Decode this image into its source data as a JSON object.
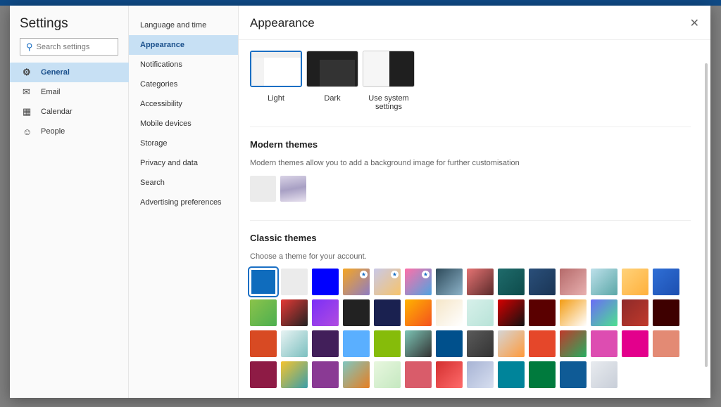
{
  "settings": {
    "title": "Settings",
    "search_placeholder": "Search settings",
    "categories": [
      {
        "label": "General",
        "icon": "gear-icon",
        "selected": true
      },
      {
        "label": "Email",
        "icon": "mail-icon"
      },
      {
        "label": "Calendar",
        "icon": "calendar-icon"
      },
      {
        "label": "People",
        "icon": "people-icon"
      }
    ]
  },
  "subnav": [
    {
      "label": "Language and time"
    },
    {
      "label": "Appearance",
      "selected": true
    },
    {
      "label": "Notifications"
    },
    {
      "label": "Categories"
    },
    {
      "label": "Accessibility"
    },
    {
      "label": "Mobile devices"
    },
    {
      "label": "Storage"
    },
    {
      "label": "Privacy and data"
    },
    {
      "label": "Search"
    },
    {
      "label": "Advertising preferences"
    }
  ],
  "main": {
    "title": "Appearance",
    "close_icon": "close-icon",
    "modes": [
      {
        "label": "Light",
        "selected": true
      },
      {
        "label": "Dark"
      },
      {
        "label": "Use system settings"
      }
    ],
    "modern": {
      "title": "Modern themes",
      "description": "Modern themes allow you to add a background image for further customisation"
    },
    "classic": {
      "title": "Classic themes",
      "description": "Choose a theme for your account."
    }
  },
  "accent": "#1a6fc4",
  "classic_tiles": [
    [
      "#0f6cbd"
    ],
    [
      "#ebebeb"
    ],
    [
      "#0000ff"
    ],
    [
      "#f5a623",
      "#8e7cc3",
      1
    ],
    [
      "#c9c9e8",
      "#f6c36b",
      1
    ],
    [
      "#ff6fa8",
      "#4fa3e0",
      1
    ],
    [
      "#2d4a5a",
      "#8db3c9"
    ],
    [
      "#e57373",
      "#5a2a2a"
    ],
    [
      "#1f6b6b",
      "#0d4b4b"
    ],
    [
      "#2a4f7a",
      "#1a3555"
    ],
    [
      "#b56a6a",
      "#e8b0b0"
    ],
    [
      "#bde0ea",
      "#5aa7a7"
    ],
    [
      "#ffd27a",
      "#ffb03b"
    ],
    [
      "#2f6fd6",
      "#1d4fb0"
    ],
    [
      "#8bc34a",
      "#4caf50"
    ],
    [
      "#e53935",
      "#222222"
    ],
    [
      "#7b2ff7",
      "#b04ce0"
    ],
    [
      "#222222"
    ],
    [
      "#1a2150"
    ],
    [
      "#ffb300",
      "#f4511e"
    ],
    [
      "#f5e6c8",
      "#ffffff"
    ],
    [
      "#d7f0ea",
      "#b8e3d8"
    ],
    [
      "#d50000",
      "#111111"
    ],
    [
      "#5a0000"
    ],
    [
      "#f39c12",
      "#ffffff"
    ],
    [
      "#6a6cf6",
      "#4ee08f"
    ],
    [
      "#8e2a2a",
      "#c0392b"
    ],
    [
      "#3e0000"
    ],
    [
      "#d84a23"
    ],
    [
      "#e8f3f3",
      "#7bbfbf"
    ],
    [
      "#421f5a"
    ],
    [
      "#5aafff"
    ],
    [
      "#86bc0a"
    ],
    [
      "#7cc4b5",
      "#333333"
    ],
    [
      "#00508c"
    ],
    [
      "#5a5a5a",
      "#333333"
    ],
    [
      "#d5d5d5",
      "#ff9a3c"
    ],
    [
      "#e5472a"
    ],
    [
      "#c0392b",
      "#27ae60"
    ],
    [
      "#dd4db1"
    ],
    [
      "#e3008c"
    ],
    [
      "#e38a74"
    ],
    [
      "#8e1b45"
    ],
    [
      "#f4c430",
      "#3b9ea8"
    ],
    [
      "#8a3a94"
    ],
    [
      "#7fc7c0",
      "#e67e22"
    ],
    [
      "#e8f7df",
      "#c5e8c0"
    ],
    [
      "#d95c6a"
    ],
    [
      "#d32f2f",
      "#ff6b6b"
    ],
    [
      "#a7b3d4",
      "#d7dff0"
    ],
    [
      "#00849a"
    ],
    [
      "#007a3d"
    ],
    [
      "#0f5b96"
    ],
    [
      "#e8ebef",
      "#c8ced8"
    ]
  ]
}
